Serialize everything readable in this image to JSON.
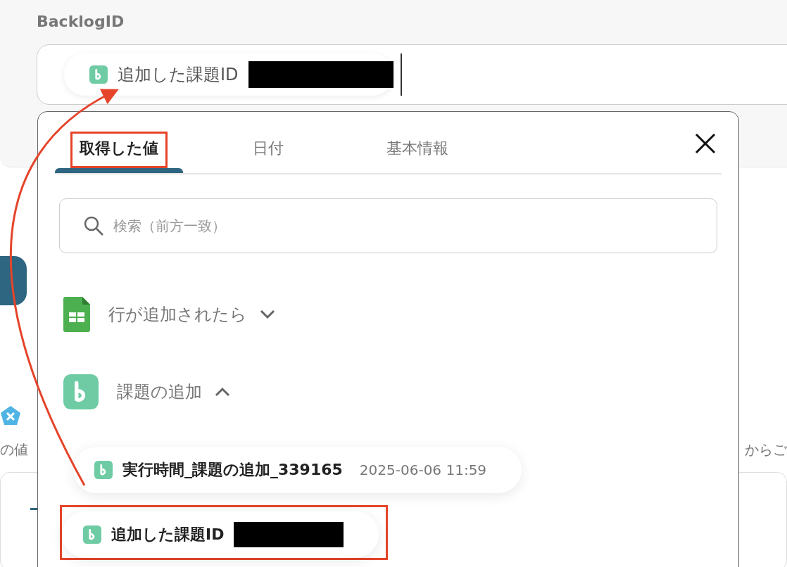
{
  "field": {
    "label": "BacklogID",
    "chip": {
      "text": "追加した課題ID",
      "redacted": true
    }
  },
  "background": {
    "note_left": "の値",
    "note_right": "からご"
  },
  "picker": {
    "tabs": [
      {
        "label": "取得した値",
        "selected": true,
        "highlighted": true
      },
      {
        "label": "日付",
        "selected": false,
        "highlighted": false
      },
      {
        "label": "基本情報",
        "selected": false,
        "highlighted": false
      }
    ],
    "search": {
      "placeholder": "検索（前方一致）"
    },
    "groups": [
      {
        "kind": "sheets",
        "title": "行が追加されたら",
        "expanded": false
      },
      {
        "kind": "backlog",
        "title": "課題の追加",
        "expanded": true,
        "items": [
          {
            "name": "実行時間_課題の追加_339165",
            "value": "2025-06-06 11:59",
            "highlighted": false
          },
          {
            "name": "追加した課題ID",
            "redacted": true,
            "highlighted": true
          }
        ]
      }
    ]
  }
}
